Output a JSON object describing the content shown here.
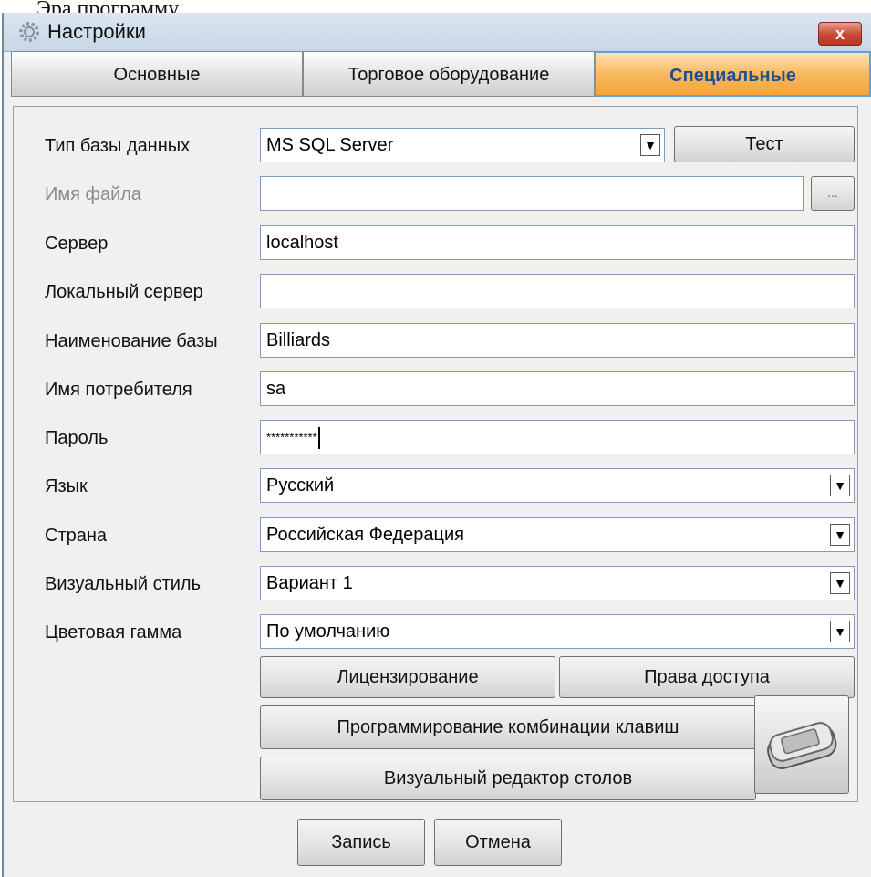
{
  "page_top_text": "Эра программу",
  "window": {
    "title": "Настройки",
    "close_label": "x"
  },
  "tabs": [
    {
      "label": "Основные",
      "active": false
    },
    {
      "label": "Торговое оборудование",
      "active": false
    },
    {
      "label": "Специальные",
      "active": true
    }
  ],
  "form": {
    "db_type": {
      "label": "Тип базы данных",
      "value": "MS SQL Server",
      "test_button": "Тест"
    },
    "file_name": {
      "label": "Имя файла",
      "value": "",
      "browse_label": "..."
    },
    "server": {
      "label": "Сервер",
      "value": "localhost"
    },
    "local_server": {
      "label": "Локальный сервер",
      "value": ""
    },
    "db_name": {
      "label": "Наименование базы",
      "value": "Billiards"
    },
    "user": {
      "label": "Имя потребителя",
      "value": "sa"
    },
    "password": {
      "label": "Пароль",
      "value": "***********"
    },
    "language": {
      "label": "Язык",
      "value": "Русский"
    },
    "country": {
      "label": "Страна",
      "value": "Российская Федерация"
    },
    "visual_style": {
      "label": "Визуальный стиль",
      "value": "Вариант 1"
    },
    "color_scheme": {
      "label": "Цветовая гамма",
      "value": "По умолчанию"
    }
  },
  "buttons": {
    "licensing": "Лицензирование",
    "access_rights": "Права доступа",
    "key_combos": "Программирование комбинации клавиш",
    "table_editor": "Визуальный редактор столов",
    "save": "Запись",
    "cancel": "Отмена"
  },
  "icons": {
    "title": "settings-gear-icon",
    "dropdown": "chevron-down-icon",
    "touchpad": "touchpad-device-icon"
  },
  "colors": {
    "active_tab": "#f8b95e",
    "active_tab_border": "#5ba3dc",
    "close_button": "#c7472f",
    "window_bg": "#f0f0f0"
  }
}
